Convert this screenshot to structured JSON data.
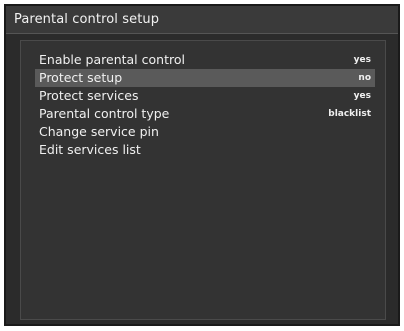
{
  "window": {
    "title": "Parental control setup"
  },
  "menu": {
    "items": [
      {
        "label": "Enable parental control",
        "value": "yes"
      },
      {
        "label": "Protect setup",
        "value": "no"
      },
      {
        "label": "Protect services",
        "value": "yes"
      },
      {
        "label": "Parental control type",
        "value": "blacklist"
      },
      {
        "label": "Change service pin",
        "value": ""
      },
      {
        "label": "Edit services list",
        "value": ""
      }
    ],
    "selected_index": 1
  },
  "colors": {
    "background": "#2b2b2b",
    "panel": "#333333",
    "highlight": "#5a5a5a",
    "text": "#f0f0f0"
  }
}
